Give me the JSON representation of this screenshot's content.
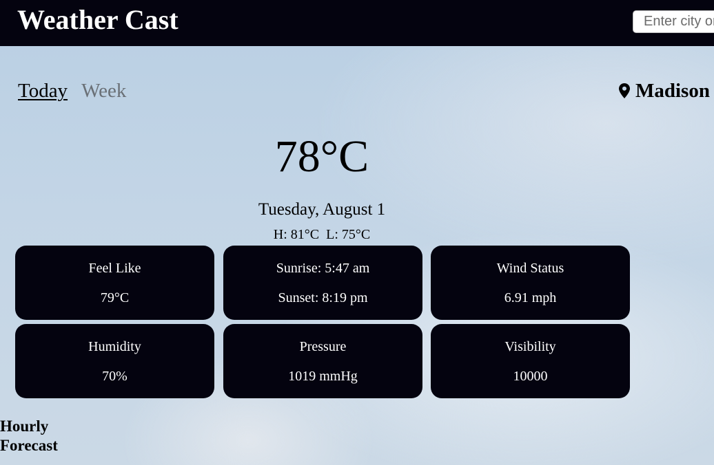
{
  "header": {
    "brand": "Weather Cast",
    "search_placeholder": "Enter city or"
  },
  "tabs": {
    "today": "Today",
    "week": "Week"
  },
  "location": {
    "icon": "location-pin-icon",
    "city": "Madison"
  },
  "current": {
    "temperature": "78°C",
    "date": "Tuesday, August 1",
    "high_low": "H: 81°C  L: 75°C"
  },
  "cards": {
    "feel_like": {
      "label": "Feel Like",
      "value": "79°C"
    },
    "sun": {
      "sunrise": "Sunrise: 5:47 am",
      "sunset": "Sunset: 8:19 pm"
    },
    "wind": {
      "label": "Wind Status",
      "value": "6.91 mph"
    },
    "humidity": {
      "label": "Humidity",
      "value": "70%"
    },
    "pressure": {
      "label": "Pressure",
      "value": "1019 mmHg"
    },
    "visibility": {
      "label": "Visibility",
      "value": "10000"
    }
  },
  "hourly": {
    "title": "Hourly Forecast"
  },
  "colors": {
    "dark": "#04030f",
    "sky": "#c3d5e6",
    "inactive_tab": "#6a7076"
  }
}
